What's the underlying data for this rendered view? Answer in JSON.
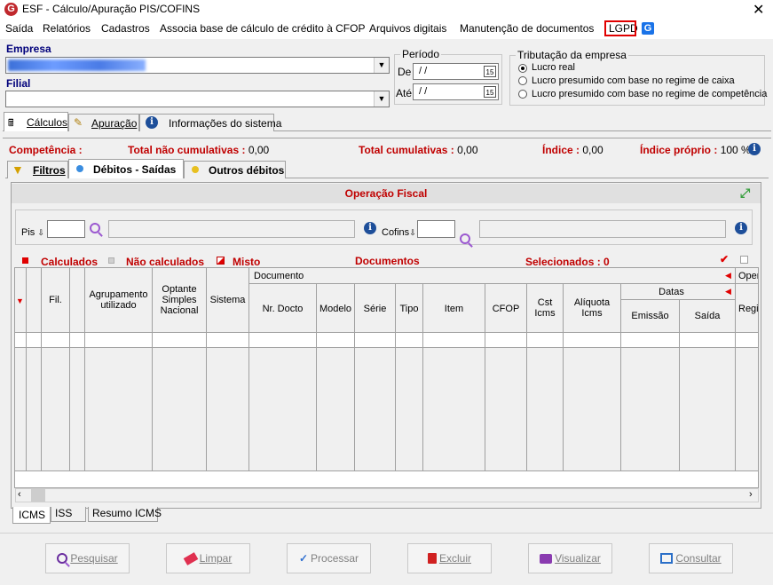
{
  "window": {
    "title": "ESF - Cálculo/Apuração PIS/COFINS",
    "close_glyph": "✕"
  },
  "menu": [
    "Saída",
    "Relatórios",
    "Cadastros",
    "Associa base de cálculo de crédito à CFOP",
    "Arquivos digitais",
    "Manutenção de documentos",
    "LGPD"
  ],
  "empresa": {
    "label": "Empresa",
    "value": ""
  },
  "filial": {
    "label": "Filial",
    "value": ""
  },
  "periodo": {
    "title": "Período",
    "de_label": "De",
    "de_value": "/ /",
    "ate_label": "Até",
    "ate_value": "/ /",
    "calendar_glyph": "15"
  },
  "tributacao": {
    "title": "Tributação da empresa",
    "options": [
      "Lucro real",
      "Lucro presumido com base no regime de caixa",
      "Lucro presumido com base no regime de competência"
    ],
    "selected": 0
  },
  "main_tabs": [
    "Cálculos",
    "Apuração",
    "Informações do sistema"
  ],
  "summary": {
    "competencia_label": "Competência :",
    "total_nao_cum_label": "Total não cumulativas :",
    "total_nao_cum_value": "0,00",
    "total_cum_label": "Total cumulativas :",
    "total_cum_value": "0,00",
    "indice_label": "Índice :",
    "indice_value": "0,00",
    "indice_proprio_label": "Índice próprio :",
    "indice_proprio_value": "100 %"
  },
  "sub_tabs": [
    "Filtros",
    "Débitos - Saídas",
    "Outros débitos"
  ],
  "operacao": {
    "title": "Operação Fiscal",
    "pis_label": "Pis",
    "cofins_label": "Cofins",
    "sort_glyph": "⇩"
  },
  "legend": {
    "calculados": "Calculados",
    "nao_calculados": "Não calculados",
    "misto": "Misto",
    "documentos": "Documentos",
    "selecionados": "Selecionados : 0"
  },
  "columns": {
    "fil": "Fil.",
    "agrupamento": "Agrupamento utilizado",
    "optante": "Optante Simples Nacional",
    "sistema": "Sistema",
    "documento": "Documento",
    "nr_docto": "Nr. Docto",
    "modelo": "Modelo",
    "serie": "Série",
    "tipo": "Tipo",
    "item": "Item",
    "cfop": "CFOP",
    "cst": "Cst Icms",
    "aliquota": "Alíquota Icms",
    "datas": "Datas",
    "emissao": "Emissão",
    "saida": "Saída",
    "oper": "Oper",
    "regi": "Regi"
  },
  "bottom_tabs": [
    "ICMS",
    "ISS",
    "Resumo ICMS"
  ],
  "buttons": [
    "Pesquisar",
    "Limpar",
    "Processar",
    "Excluir",
    "Visualizar",
    "Consultar"
  ],
  "colors": {
    "accent_red": "#c00000",
    "label_blue": "#00007b"
  }
}
